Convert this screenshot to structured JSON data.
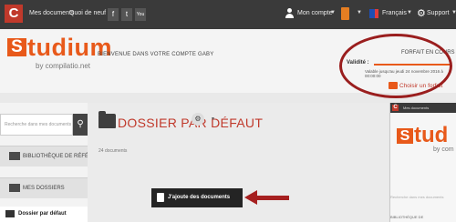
{
  "topbar": {
    "brand_letter": "C",
    "links": [
      "Mes documents",
      "Quoi de neuf ?"
    ],
    "social": [
      "f",
      "t",
      "You"
    ],
    "account": "Mon compte",
    "language": "Français",
    "support": "Support"
  },
  "header": {
    "logo_word": "tudium",
    "logo_letter": "S",
    "logo_sub": "by compilatio.net",
    "welcome": "BIENVENUE DANS VOTRE COMPTE GABY",
    "forfait_title": "FORFAIT EN COURS",
    "validite_label": "Validité :",
    "validite_note": "Valable jusqu'au jeudi 24 novembre 2016 à 00:00:00",
    "forfait_link": "Choisir un forfait"
  },
  "sidebar": {
    "search_placeholder": "Recherche dans mes documents",
    "items": [
      {
        "label": "BIBLIOTHÈQUE DE RÉFÉRENCES"
      },
      {
        "label": "MES DOSSIERS"
      }
    ],
    "active_folder": "Dossier par défaut"
  },
  "main": {
    "title": "DOSSIER PAR DÉFAUT",
    "doc_count": "24 documents",
    "add_button": "J'ajoute des documents"
  },
  "inset": {
    "nav": "Mes documents",
    "logo_letter": "S",
    "logo_word": "tud",
    "logo_sub": "by com",
    "search_placeholder": "Recherche dans mes documents",
    "bottom_item": "BIBLIOTHÈQUE DE"
  },
  "colors": {
    "accent": "#e8591a",
    "brand_red": "#c0392b",
    "annotation_red": "#a62020"
  }
}
